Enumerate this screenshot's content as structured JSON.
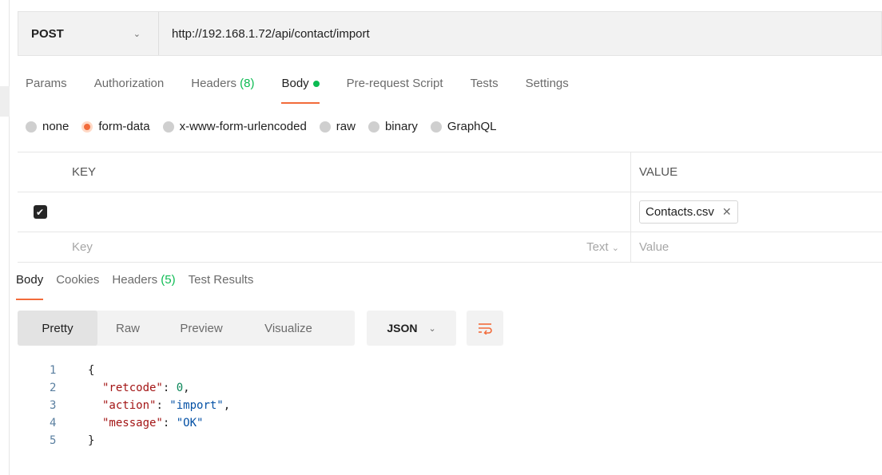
{
  "request": {
    "method": "POST",
    "url": "http://192.168.1.72/api/contact/import"
  },
  "request_tabs": [
    {
      "label": "Params"
    },
    {
      "label": "Authorization"
    },
    {
      "label": "Headers",
      "count": "(8)"
    },
    {
      "label": "Body"
    },
    {
      "label": "Pre-request Script"
    },
    {
      "label": "Tests"
    },
    {
      "label": "Settings"
    }
  ],
  "body_types": [
    "none",
    "form-data",
    "x-www-form-urlencoded",
    "raw",
    "binary",
    "GraphQL"
  ],
  "selected_body_type": "form-data",
  "form_table": {
    "headers": {
      "key": "KEY",
      "value": "VALUE"
    },
    "rows": [
      {
        "checked": true,
        "key": "",
        "value_file": "Contacts.csv"
      }
    ],
    "new_row": {
      "key_placeholder": "Key",
      "type": "Text",
      "value_placeholder": "Value"
    }
  },
  "response_tabs": [
    {
      "label": "Body"
    },
    {
      "label": "Cookies"
    },
    {
      "label": "Headers",
      "count": "(5)"
    },
    {
      "label": "Test Results"
    }
  ],
  "view_modes": [
    "Pretty",
    "Raw",
    "Preview",
    "Visualize"
  ],
  "format": "JSON",
  "code": {
    "line_numbers": [
      "1",
      "2",
      "3",
      "4",
      "5"
    ],
    "open_brace": "{",
    "close_brace": "}",
    "entries": [
      {
        "key": "\"retcode\"",
        "value": "0",
        "comma": ","
      },
      {
        "key": "\"action\"",
        "value": "\"import\"",
        "comma": ","
      },
      {
        "key": "\"message\"",
        "value": "\"OK\"",
        "comma": ""
      }
    ]
  },
  "colors": {
    "accent": "#f26b3a",
    "success": "#0cbb52"
  }
}
